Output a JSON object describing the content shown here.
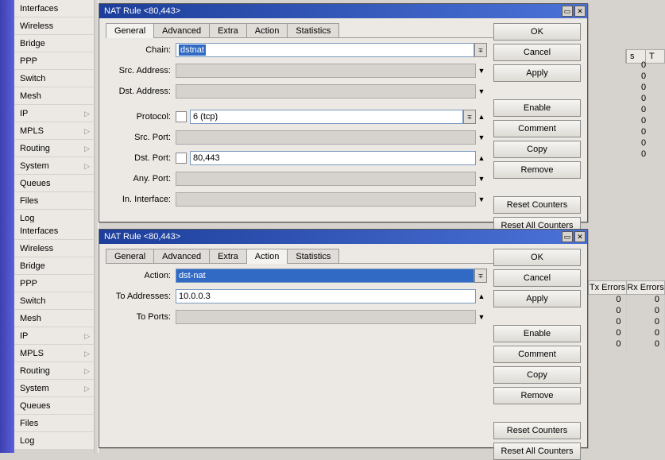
{
  "sidebar_top": [
    {
      "label": "Interfaces",
      "arrow": false
    },
    {
      "label": "Wireless",
      "arrow": false
    },
    {
      "label": "Bridge",
      "arrow": false
    },
    {
      "label": "PPP",
      "arrow": false
    },
    {
      "label": "Switch",
      "arrow": false
    },
    {
      "label": "Mesh",
      "arrow": false
    },
    {
      "label": "IP",
      "arrow": true
    },
    {
      "label": "MPLS",
      "arrow": true
    },
    {
      "label": "Routing",
      "arrow": true
    },
    {
      "label": "System",
      "arrow": true
    },
    {
      "label": "Queues",
      "arrow": false
    },
    {
      "label": "Files",
      "arrow": false
    },
    {
      "label": "Log",
      "arrow": false
    }
  ],
  "sidebar_bottom": [
    {
      "label": "Interfaces",
      "arrow": false
    },
    {
      "label": "Wireless",
      "arrow": false
    },
    {
      "label": "Bridge",
      "arrow": false
    },
    {
      "label": "PPP",
      "arrow": false
    },
    {
      "label": "Switch",
      "arrow": false
    },
    {
      "label": "Mesh",
      "arrow": false
    },
    {
      "label": "IP",
      "arrow": true
    },
    {
      "label": "MPLS",
      "arrow": true
    },
    {
      "label": "Routing",
      "arrow": true
    },
    {
      "label": "System",
      "arrow": true
    },
    {
      "label": "Queues",
      "arrow": false
    },
    {
      "label": "Files",
      "arrow": false
    },
    {
      "label": "Log",
      "arrow": false
    }
  ],
  "dialog1": {
    "title": "NAT Rule <80,443>",
    "tabs": [
      "General",
      "Advanced",
      "Extra",
      "Action",
      "Statistics"
    ],
    "active_tab": 0,
    "fields": {
      "chain_label": "Chain:",
      "chain_value": "dstnat",
      "src_addr_label": "Src. Address:",
      "dst_addr_label": "Dst. Address:",
      "protocol_label": "Protocol:",
      "protocol_value": "6 (tcp)",
      "src_port_label": "Src. Port:",
      "dst_port_label": "Dst. Port:",
      "dst_port_value": "80,443",
      "any_port_label": "Any. Port:",
      "in_iface_label": "In. Interface:"
    }
  },
  "dialog2": {
    "title": "NAT Rule <80,443>",
    "tabs": [
      "General",
      "Advanced",
      "Extra",
      "Action",
      "Statistics"
    ],
    "active_tab": 3,
    "fields": {
      "action_label": "Action:",
      "action_value": "dst-nat",
      "to_addr_label": "To Addresses:",
      "to_addr_value": "10.0.0.3",
      "to_ports_label": "To Ports:"
    }
  },
  "buttons": {
    "ok": "OK",
    "cancel": "Cancel",
    "apply": "Apply",
    "enable": "Enable",
    "comment": "Comment",
    "copy": "Copy",
    "remove": "Remove",
    "reset_counters": "Reset Counters",
    "reset_all_counters": "Reset All Counters"
  },
  "bg_headers_bottom": [
    "Tx Errors",
    "Rx Errors"
  ],
  "bg_headers_top": [
    "s",
    "T"
  ],
  "bg_zero": "0"
}
